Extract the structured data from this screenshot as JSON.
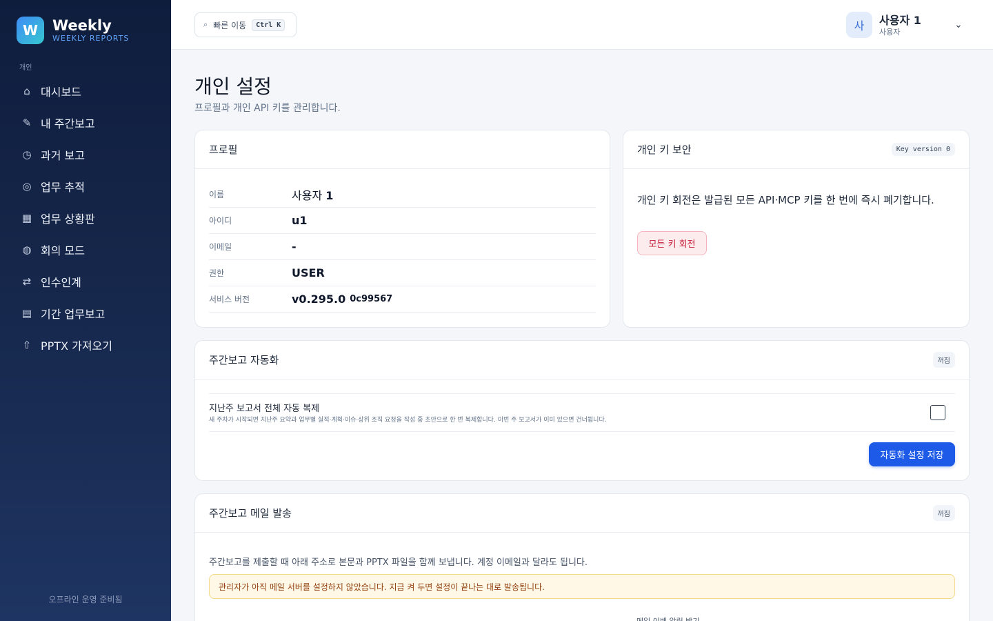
{
  "brand": {
    "logo_letter": "W",
    "name": "Weekly",
    "subtitle": "WEEKLY REPORTS"
  },
  "sidebar": {
    "section_label": "개인",
    "items": [
      {
        "icon": "home-icon",
        "glyph": "⌂",
        "label": "대시보드"
      },
      {
        "icon": "pencil-icon",
        "glyph": "✎",
        "label": "내 주간보고"
      },
      {
        "icon": "clock-icon",
        "glyph": "◷",
        "label": "과거 보고"
      },
      {
        "icon": "target-icon",
        "glyph": "◎",
        "label": "업무 추적"
      },
      {
        "icon": "grid-icon",
        "glyph": "▦",
        "label": "업무 상황판"
      },
      {
        "icon": "globe-icon",
        "glyph": "◍",
        "label": "회의 모드"
      },
      {
        "icon": "swap-icon",
        "glyph": "⇄",
        "label": "인수인계"
      },
      {
        "icon": "list-icon",
        "glyph": "▤",
        "label": "기간 업무보고"
      },
      {
        "icon": "upload-icon",
        "glyph": "⇧",
        "label": "PPTX 가져오기"
      }
    ],
    "footer": "오프라인 운영 준비됨"
  },
  "header": {
    "quick_search": {
      "icon": "search-icon",
      "glyph": "⌕",
      "label": "빠른 이동",
      "shortcut": "Ctrl K"
    },
    "user": {
      "avatar": "사",
      "name": "사용자 1",
      "role": "사용자",
      "chevron": "⌄"
    }
  },
  "page": {
    "title": "개인 설정",
    "subtitle": "프로필과 개인 API 키를 관리합니다."
  },
  "profile": {
    "title": "프로필",
    "rows": [
      {
        "key": "이름",
        "value": "사용자 1"
      },
      {
        "key": "아이디",
        "value": "u1"
      },
      {
        "key": "이메일",
        "value": "-"
      },
      {
        "key": "권한",
        "value": "USER"
      },
      {
        "key": "서비스 버전",
        "value": "v0.295.0",
        "extra": "0c99567"
      }
    ]
  },
  "security": {
    "title": "개인 키 보안",
    "badge": "Key version 0",
    "description": "개인 키 회전은 발급된 모든 API·MCP 키를 한 번에 즉시 폐기합니다.",
    "button": "모든 키 회전"
  },
  "automation": {
    "title": "주간보고 자동화",
    "status": "꺼짐",
    "option_title": "지난주 보고서 전체 자동 복제",
    "option_desc": "새 주차가 시작되면 지난주 요약과 업무별 실적·계획·이슈·상위 조직 요청을 작성 중 초안으로 한 번 복제합니다. 이번 주 보고서가 이미 있으면 건너뜁니다.",
    "checked": false,
    "save_button": "자동화 설정 저장"
  },
  "mail": {
    "title": "주간보고 메일 발송",
    "status": "꺼짐",
    "description": "주간보고를 제출할 때 아래 주소로 본문과 PPTX 파일을 함께 보냅니다. 계정 이메일과 달라도 됩니다.",
    "warning": "관리자가 아직 메일 서버를 설정하지 않았습니다. 지금 켜 두면 설정이 끝나는 대로 발송됩니다.",
    "link": "메일 이벤 알림 받기"
  }
}
